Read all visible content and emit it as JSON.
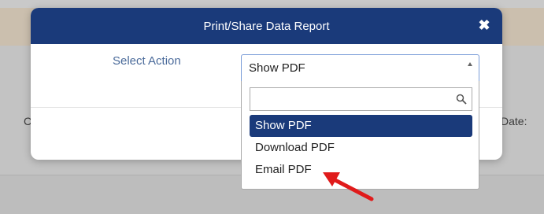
{
  "background": {
    "left_fragment": "C",
    "right_fragment": "Date:"
  },
  "modal": {
    "title": "Print/Share Data Report",
    "close_icon": "close-icon"
  },
  "form": {
    "label": "Select Action",
    "selected": "Show PDF"
  },
  "dropdown": {
    "search_value": "",
    "options": [
      "Show PDF",
      "Download PDF",
      "Email PDF"
    ],
    "highlighted_index": 0
  },
  "colors": {
    "header": "#1a3a7a",
    "highlight": "#1a3a7a",
    "arrow": "#e01b1b"
  }
}
